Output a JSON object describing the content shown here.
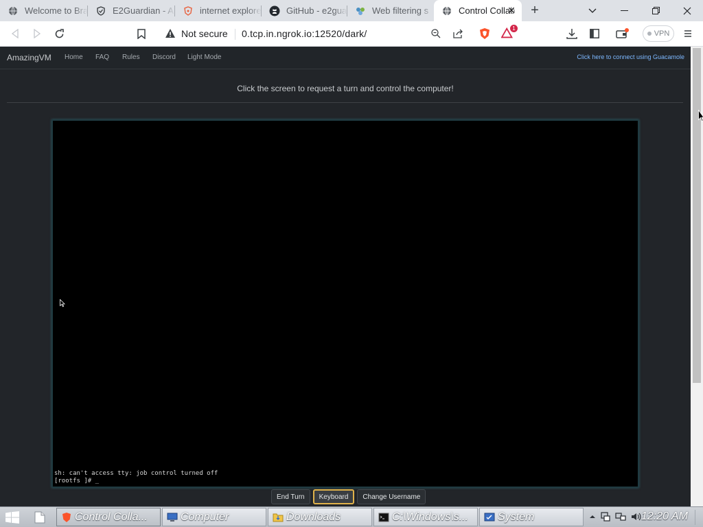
{
  "browser": {
    "tabs": [
      {
        "title": "Welcome to Brave",
        "icon": "globe-icon",
        "active": false
      },
      {
        "title": "E2Guardian - A",
        "icon": "shield-icon",
        "active": false
      },
      {
        "title": "internet explorer",
        "icon": "brave-icon",
        "active": false
      },
      {
        "title": "GitHub - e2guardian",
        "icon": "github-icon",
        "active": false
      },
      {
        "title": "Web filtering s",
        "icon": "web-filter-icon",
        "active": false
      },
      {
        "title": "Control Collab",
        "icon": "globe-icon",
        "active": true
      }
    ],
    "new_tab": "+",
    "security_label": "Not secure",
    "url": "0.tcp.in.ngrok.io:12520/dark/",
    "vpn_label": "VPN",
    "brave_rewards_badge": "1"
  },
  "site": {
    "brand": "AmazingVM",
    "nav": [
      "Home",
      "FAQ",
      "Rules",
      "Discord",
      "Light Mode"
    ],
    "guacamole_link": "Click here to connect using Guacamole",
    "turn_prompt": "Click the screen to request a turn and control the computer!",
    "terminal_lines": [
      "sh: can't access tty: job control turned off",
      "[rootfs ]# _"
    ],
    "buttons": {
      "end_turn": "End Turn",
      "keyboard": "Keyboard",
      "change_username": "Change Username"
    }
  },
  "taskbar": {
    "items": [
      {
        "label": "Control Colla...",
        "icon": "brave-icon"
      },
      {
        "label": "Computer",
        "icon": "computer-icon"
      },
      {
        "label": "Downloads",
        "icon": "folder-icon"
      },
      {
        "label": "C:\\Windows\\s...",
        "icon": "cmd-icon"
      },
      {
        "label": "System",
        "icon": "system-icon"
      }
    ],
    "clock": "12:20 AM"
  },
  "colors": {
    "accent_keyboard_border": "#e0b24a",
    "link": "#7db8ff",
    "page_bg": "#222529"
  }
}
